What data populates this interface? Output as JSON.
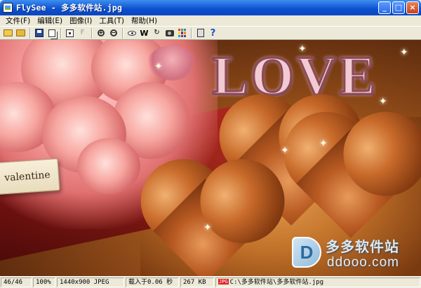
{
  "window": {
    "title": "FlySee - 多多软件站.jpg",
    "buttons": {
      "minimize": "_",
      "maximize": "□",
      "close": "×"
    }
  },
  "menu": {
    "items": [
      "文件(F)",
      "编辑(E)",
      "图像(I)",
      "工具(T)",
      "帮助(H)"
    ]
  },
  "toolbar": {
    "icons": [
      "open-folder-icon",
      "folder-icon",
      "save-icon",
      "copy-icon",
      "fit-icon",
      "actual-size-icon",
      "zoom-in-icon",
      "zoom-out-icon",
      "view-icon",
      "wallpaper-icon",
      "rotate-icon",
      "capture-icon",
      "thumbnails-icon",
      "clipboard-icon",
      "help-icon"
    ]
  },
  "image": {
    "love_text": "LOVE",
    "tag_text": "valentine",
    "watermark_cn": "多多软件站",
    "watermark_url": "ddooo.com",
    "watermark_logo": "D"
  },
  "status": {
    "index": "46/46",
    "zoom": "100%",
    "dims": "1440x900 JPEG",
    "load_time": "载入于0.06 秒",
    "size": "267 KB",
    "file_badge": "JPG",
    "path": "C:\\多多软件站\\多多软件站.jpg"
  },
  "colors": {
    "title_bar": "#0a46c1",
    "chrome": "#ece9d8",
    "close_button": "#c8421b"
  }
}
